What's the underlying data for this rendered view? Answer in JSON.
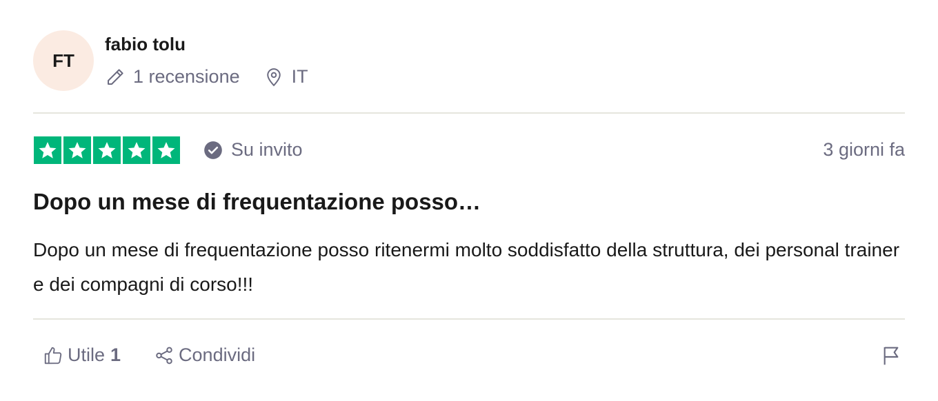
{
  "reviewer": {
    "initials": "FT",
    "name": "fabio tolu",
    "reviews_count_label": "1 recensione",
    "country": "IT",
    "avatar_color": "#fbebe2"
  },
  "rating": {
    "stars": 5,
    "max_stars": 5,
    "star_color": "#00b67a",
    "verified_label": "Su invito",
    "date_label": "3 giorni fa"
  },
  "review": {
    "title": "Dopo un mese di frequentazione posso…",
    "body": "Dopo un mese di frequentazione posso ritenermi molto soddisfatto della struttura, dei personal trainer e dei compagni di corso!!!"
  },
  "actions": {
    "useful_label": "Utile",
    "useful_count": "1",
    "share_label": "Condividi",
    "icons": [
      "thumbs-up-icon",
      "share-icon",
      "flag-icon"
    ]
  }
}
